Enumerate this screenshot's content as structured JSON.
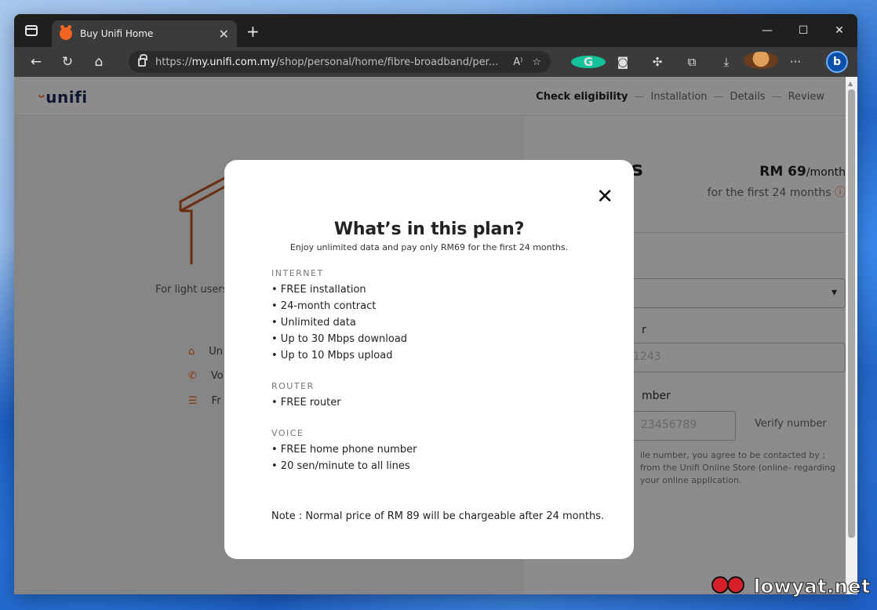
{
  "browser": {
    "tab_title": "Buy Unifi Home",
    "url_prefix": "https://",
    "url_domain": "my.unifi.com.my",
    "url_path": "/shop/personal/home/fibre-broadband/per..."
  },
  "site": {
    "logo": "unifi",
    "steps": [
      "Check eligibility",
      "Installation",
      "Details",
      "Review"
    ],
    "plan_name": "30 Mbps",
    "price": "RM 69",
    "price_unit": "/month",
    "price_sub": "for the first 24 months",
    "description": "For light users, using... from home, online le...",
    "features": [
      "Un",
      "Vo",
      "Fr"
    ],
    "placeholder_1": "1243",
    "label_number": "mber",
    "placeholder_2": "23456789",
    "verify_label": "Verify number",
    "contact_note": "ile number, you agree to be contacted by ; from the Unifi Online Store (online- regarding your online application."
  },
  "modal": {
    "title": "What’s in this plan?",
    "subtitle": "Enjoy unlimited data and pay only RM69 for the first 24 months.",
    "sections": [
      {
        "heading": "INTERNET",
        "items": [
          "• FREE installation",
          "• 24-month contract",
          "• Unlimited data",
          "• Up to 30 Mbps download",
          "• Up to 10 Mbps upload"
        ]
      },
      {
        "heading": "ROUTER",
        "items": [
          "• FREE router"
        ]
      },
      {
        "heading": "VOICE",
        "items": [
          "• FREE home phone number",
          "• 20 sen/minute to all lines"
        ]
      }
    ],
    "note": "Note : Normal price of RM 89 will be chargeable after 24 months."
  },
  "watermark": "lowyat.net",
  "colors": {
    "brand": "#f26422",
    "overlay": "rgba(0,0,0,0.45)"
  }
}
